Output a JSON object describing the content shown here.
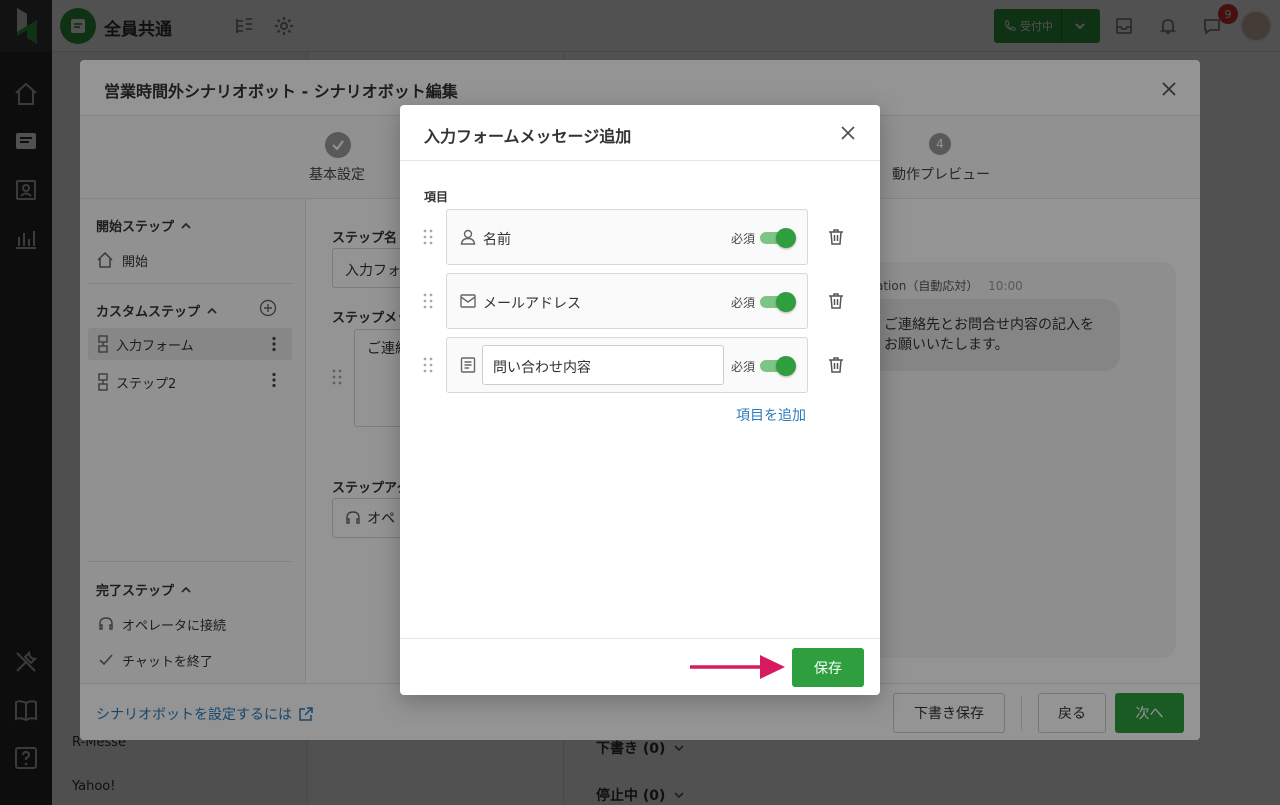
{
  "topbar": {
    "team_name": "全員共通",
    "status_label": "受付中",
    "notification_count": "9"
  },
  "background": {
    "sidebar_items": [
      "R-Messe",
      "Yahoo!"
    ],
    "draft_heading": "下書き (0)",
    "paused_heading": "停止中 (0)",
    "chat_sender": "ation（自動応対）",
    "chat_time": "10:00",
    "chat_text": "ご連絡先とお問合せ内容の記入をお願いいたします。"
  },
  "editor": {
    "title": "営業時間外シナリオボット - シナリオボット編集",
    "steps": [
      {
        "number": "",
        "label": "基本設定",
        "done": true
      },
      {
        "number": "4",
        "label": "動作プレビュー",
        "done": false
      }
    ],
    "sidebar": {
      "start_section": "開始ステップ",
      "start_item": "開始",
      "custom_section": "カスタムステップ",
      "custom_items": [
        "入力フォーム",
        "ステップ2"
      ],
      "finish_section": "完了ステップ",
      "finish_items": [
        "オペレータに接続",
        "チャットを終了"
      ]
    },
    "form": {
      "step_name_label": "ステップ名",
      "step_name_value": "入力フォ",
      "step_message_label": "ステップメッ",
      "step_message_value": "ご連絡",
      "step_action_label": "ステップアク",
      "step_action_value": "オペ"
    },
    "footer": {
      "help_link": "シナリオボットを設定するには",
      "draft_save": "下書き保存",
      "back": "戻る",
      "next": "次へ"
    }
  },
  "dialog": {
    "title": "入力フォームメッセージ追加",
    "section_label": "項目",
    "items": [
      {
        "icon": "person-icon",
        "label": "名前",
        "required_label": "必須",
        "required": true
      },
      {
        "icon": "mail-icon",
        "label": "メールアドレス",
        "required_label": "必須",
        "required": true
      },
      {
        "icon": "document-icon",
        "label": "問い合わせ内容",
        "required_label": "必須",
        "required": true
      }
    ],
    "add_item": "項目を追加",
    "save": "保存"
  },
  "colors": {
    "brand_green": "#2e9e3f",
    "link_blue": "#2b7ab8",
    "arrow_pink": "#d81b60",
    "rail": "#2d2d2d"
  }
}
